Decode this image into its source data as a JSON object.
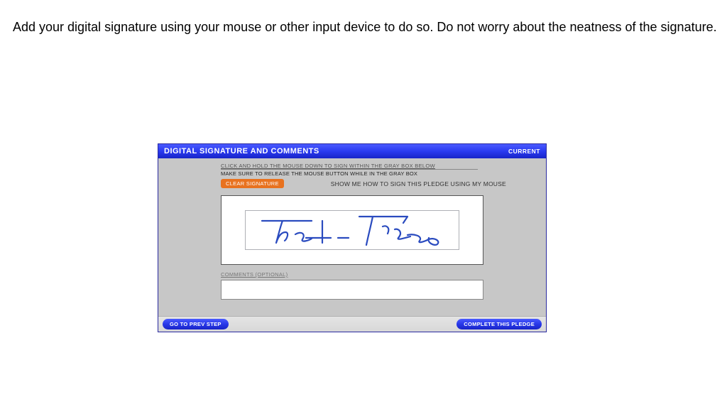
{
  "page_instruction": "Add your digital signature using your mouse or other input device to do so.  Do not worry about the neatness of the signature.",
  "panel": {
    "title": "DIGITAL SIGNATURE AND COMMENTS",
    "status": "CURRENT",
    "instruction_line1": "CLICK AND HOLD THE MOUSE DOWN TO SIGN WITHIN THE GRAY BOX BELOW",
    "instruction_line2": "MAKE SURE TO RELEASE THE MOUSE BUTTON WHILE IN THE GRAY BOX",
    "clear_button": "CLEAR SIGNATURE",
    "help_text": "SHOW ME HOW TO SIGN THIS PLEDGE USING MY MOUSE",
    "comments_label": "COMMENTS (OPTIONAL)",
    "comments_value": ""
  },
  "footer": {
    "prev": "GO TO PREV STEP",
    "complete": "COMPLETE THIS PLEDGE"
  }
}
